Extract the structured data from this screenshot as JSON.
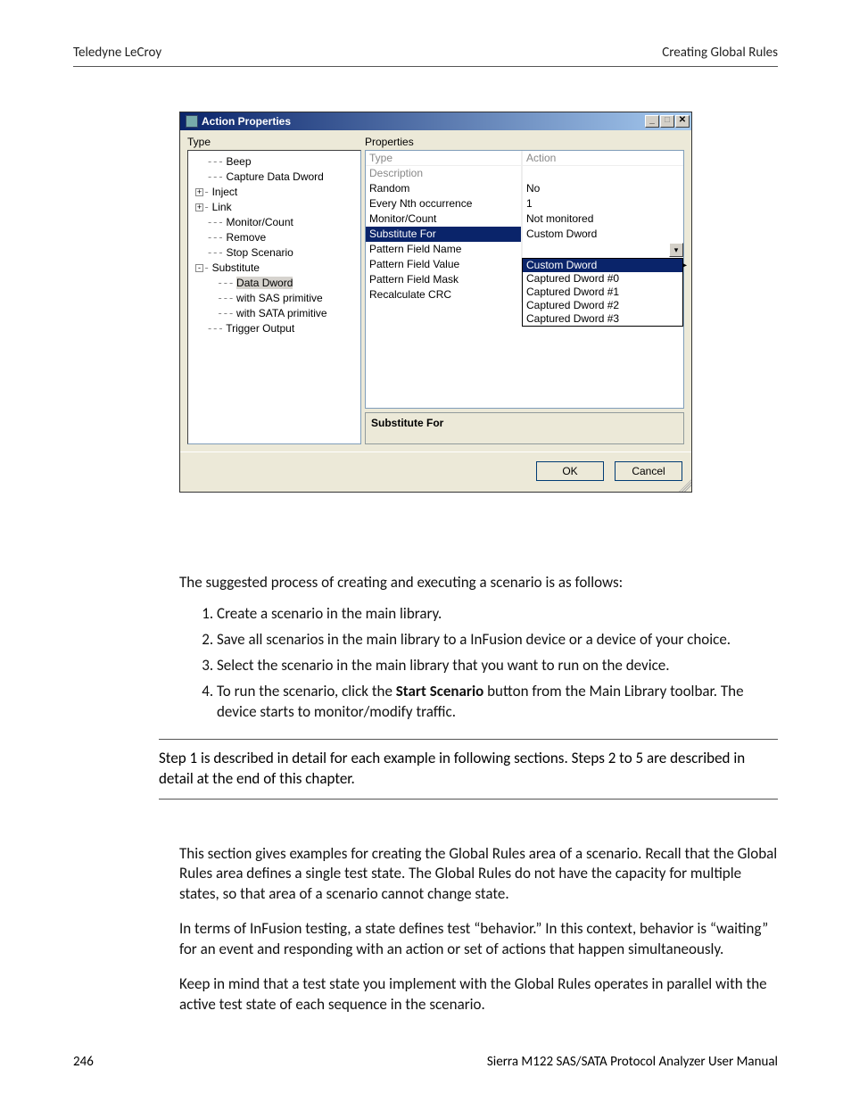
{
  "header": {
    "left": "Teledyne LeCroy",
    "right": "Creating Global Rules"
  },
  "dialog": {
    "title": "Action Properties",
    "type_label": "Type",
    "properties_label": "Properties",
    "tree": {
      "items": [
        {
          "label": "Beep",
          "level": 0,
          "expander": null
        },
        {
          "label": "Capture Data Dword",
          "level": 0,
          "expander": null
        },
        {
          "label": "Inject",
          "level": 0,
          "expander": "plus"
        },
        {
          "label": "Link",
          "level": 0,
          "expander": "plus"
        },
        {
          "label": "Monitor/Count",
          "level": 0,
          "expander": null
        },
        {
          "label": "Remove",
          "level": 0,
          "expander": null
        },
        {
          "label": "Stop Scenario",
          "level": 0,
          "expander": null
        },
        {
          "label": "Substitute",
          "level": 0,
          "expander": "minus"
        },
        {
          "label": "Data Dword",
          "level": 1,
          "expander": null,
          "selected": true
        },
        {
          "label": "with SAS primitive",
          "level": 1,
          "expander": null
        },
        {
          "label": "with SATA primitive",
          "level": 1,
          "expander": null
        },
        {
          "label": "Trigger Output",
          "level": 0,
          "expander": null
        }
      ]
    },
    "grid": {
      "header": {
        "key": "Type",
        "val": "Action"
      },
      "rows": [
        {
          "key": "Description",
          "val": "",
          "disabled": true
        },
        {
          "key": "Random",
          "val": "No"
        },
        {
          "key": "Every Nth occurrence",
          "val": "1"
        },
        {
          "key": "Monitor/Count",
          "val": "Not monitored"
        },
        {
          "key": "Substitute For",
          "val": "Custom Dword",
          "selected": true
        },
        {
          "key": "Pattern Field Name",
          "val": ""
        },
        {
          "key": "Pattern Field Value",
          "val": ""
        },
        {
          "key": "Pattern Field Mask",
          "val": ""
        },
        {
          "key": "Recalculate CRC",
          "val": ""
        }
      ],
      "dropdown": {
        "items": [
          {
            "label": "Custom Dword",
            "selected": true
          },
          {
            "label": "Captured Dword #0"
          },
          {
            "label": "Captured Dword #1"
          },
          {
            "label": "Captured Dword #2"
          },
          {
            "label": "Captured Dword #3"
          }
        ]
      }
    },
    "desc_title": "Substitute For",
    "buttons": {
      "ok": "OK",
      "cancel": "Cancel"
    }
  },
  "text": {
    "intro": "The suggested process of creating and executing a scenario is as follows:",
    "steps": [
      "Create a scenario in the main library.",
      "Save all scenarios in the main library to a InFusion device or a device of your choice.",
      "Select the scenario in the main library that you want to run on the device."
    ],
    "step4_pre": "To run the scenario, click the ",
    "step4_bold": "Start Scenario",
    "step4_post": " button from the Main Library toolbar. The device starts to monitor/modify traffic.",
    "note": "Step 1 is described in detail for each example in following sections. Steps 2 to 5 are described in detail at the end of this chapter.",
    "p1": "This section gives examples for creating the Global Rules area of a scenario. Recall that the Global Rules area defines a single test state. The Global Rules do not have the capacity for multiple states, so that area of a scenario cannot change state.",
    "p2": "In terms of InFusion testing, a state defines test “behavior.” In this context, behavior is “waiting” for an event and responding with an action or set of actions that happen simultaneously.",
    "p3": "Keep in mind that a test state you implement with the Global Rules operates in parallel with the active test state of each sequence in the scenario."
  },
  "footer": {
    "page": "246",
    "title": "Sierra M122 SAS/SATA Protocol Analyzer User Manual"
  }
}
